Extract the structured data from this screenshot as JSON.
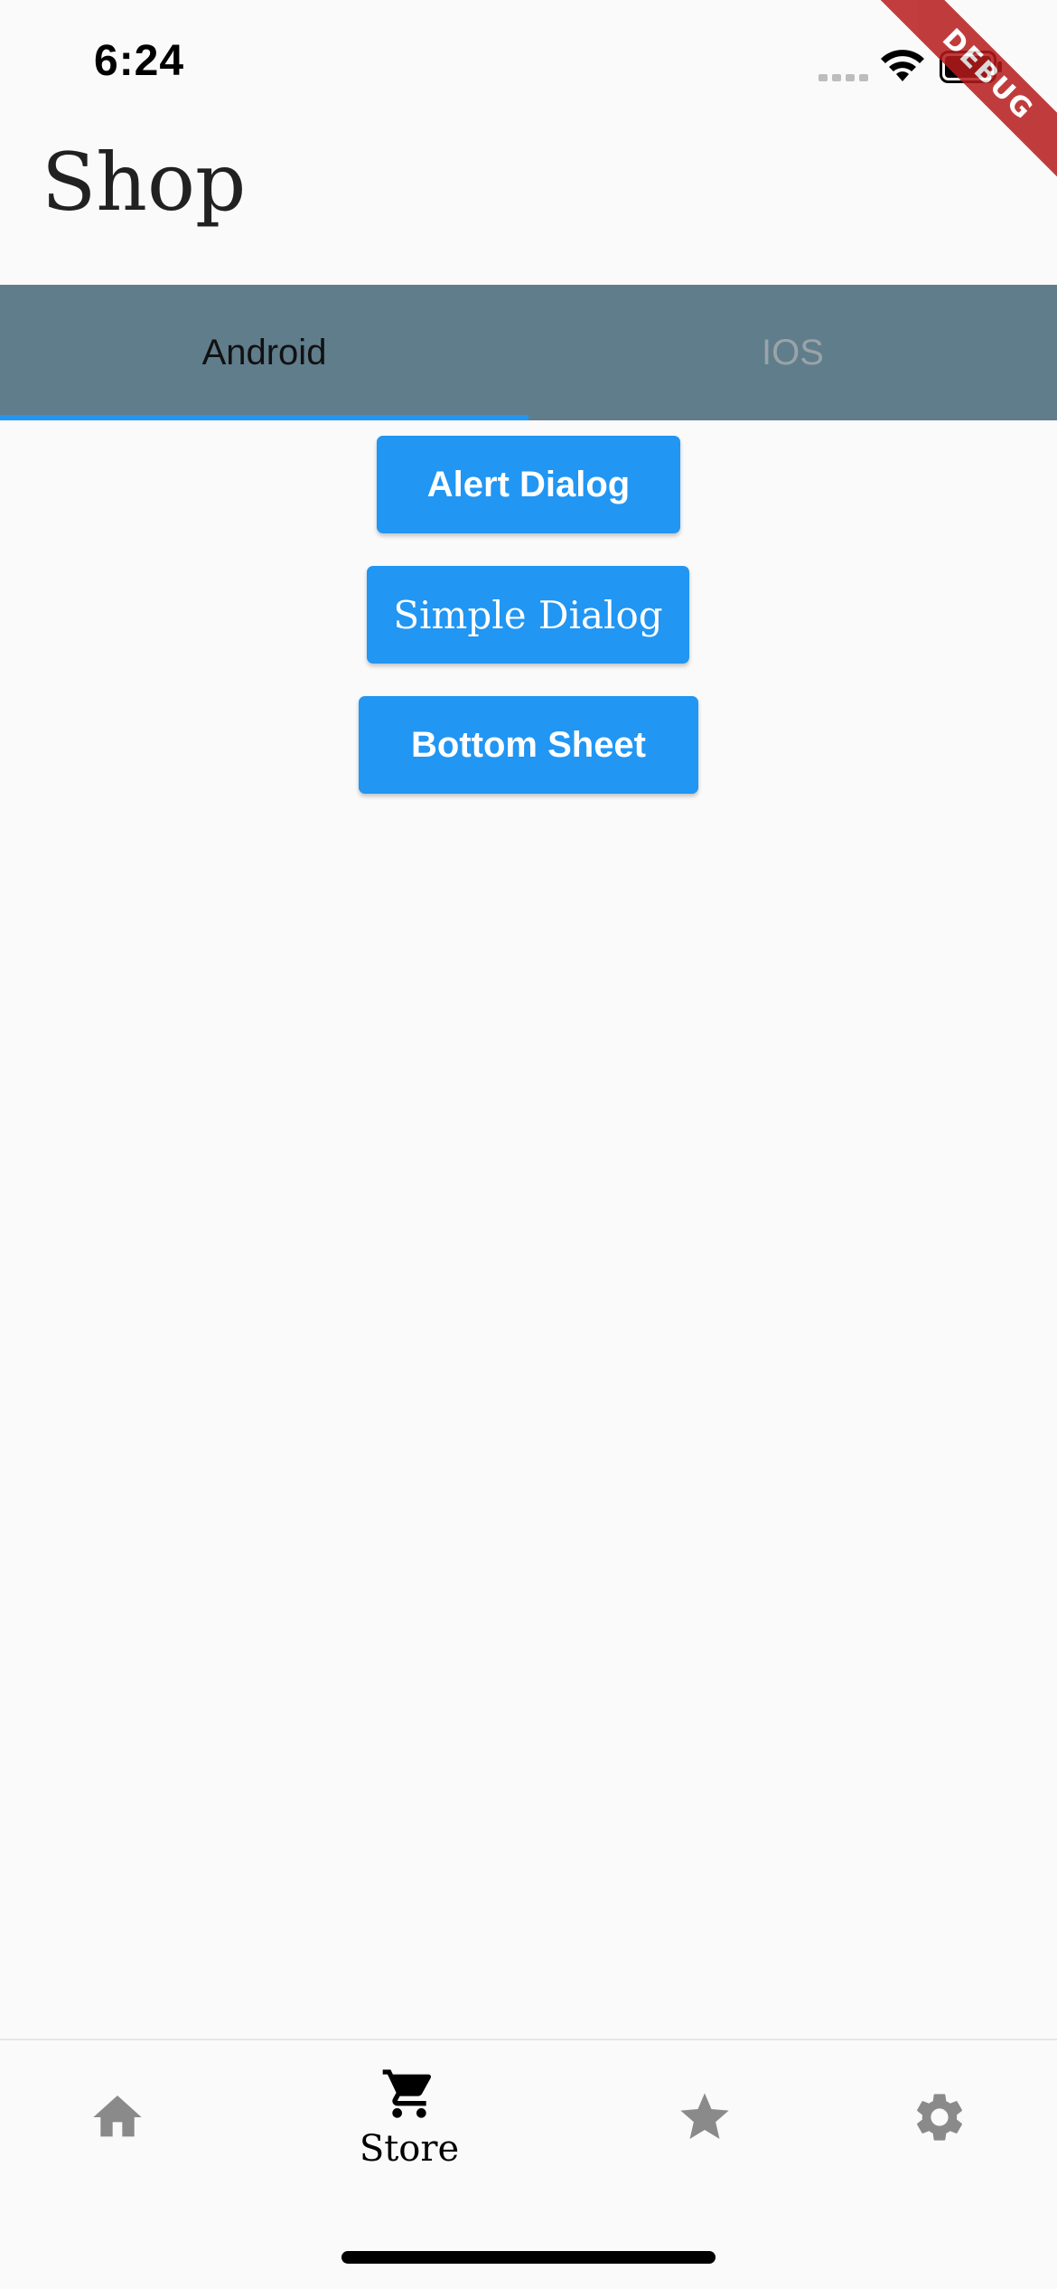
{
  "status_bar": {
    "time": "6:24"
  },
  "debug_banner": "DEBUG",
  "app_bar": {
    "title": "Shop"
  },
  "tabs": [
    {
      "label": "Android",
      "selected": true
    },
    {
      "label": "IOS",
      "selected": false
    }
  ],
  "buttons": {
    "alert_dialog": "Alert Dialog",
    "simple_dialog": "Simple Dialog",
    "bottom_sheet": "Bottom Sheet"
  },
  "bottom_nav": {
    "items": [
      {
        "icon": "home-icon",
        "label": ""
      },
      {
        "icon": "cart-icon",
        "label": "Store",
        "selected": true
      },
      {
        "icon": "star-icon",
        "label": ""
      },
      {
        "icon": "gear-icon",
        "label": ""
      }
    ]
  },
  "colors": {
    "tab_bar": "#607d8b",
    "accent": "#2196f3",
    "background": "#fafafa",
    "nav_inactive": "#8a8a8a"
  }
}
